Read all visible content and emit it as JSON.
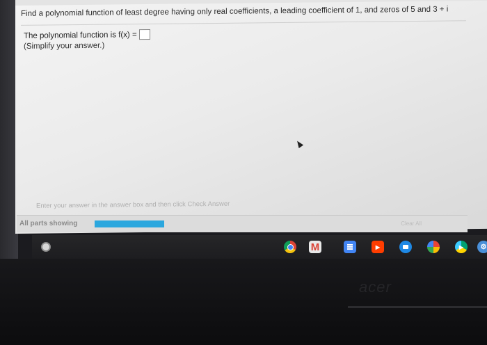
{
  "question": {
    "text": "Find a polynomial function of least degree having only real coefficients, a leading coefficient of 1, and zeros of 5 and 3 + i"
  },
  "answer": {
    "label": "The polynomial function is f(x) =",
    "value": "",
    "instruction": "(Simplify your answer.)"
  },
  "footer": {
    "hint": "Enter your answer in the answer box and then click Check Answer",
    "parts_label": "All parts showing",
    "progress": 1.0,
    "clear_all": "Clear All"
  },
  "shelf": {
    "apps": [
      {
        "icon": "chrome-icon",
        "color": "#db4437"
      },
      {
        "icon": "gmail-icon",
        "color": "#e0e0e0"
      },
      {
        "icon": "docs-icon",
        "color": "#4285f4"
      },
      {
        "icon": "youtube-icon",
        "color": "#ff3d00"
      },
      {
        "icon": "files-icon",
        "color": "#1e88e5"
      },
      {
        "icon": "photos-icon",
        "color": "#fbbc05"
      },
      {
        "icon": "play-store-icon",
        "color": "#00a173"
      },
      {
        "icon": "settings-icon",
        "color": "#4a90d9"
      }
    ]
  },
  "hardware": {
    "brand": "acer"
  }
}
